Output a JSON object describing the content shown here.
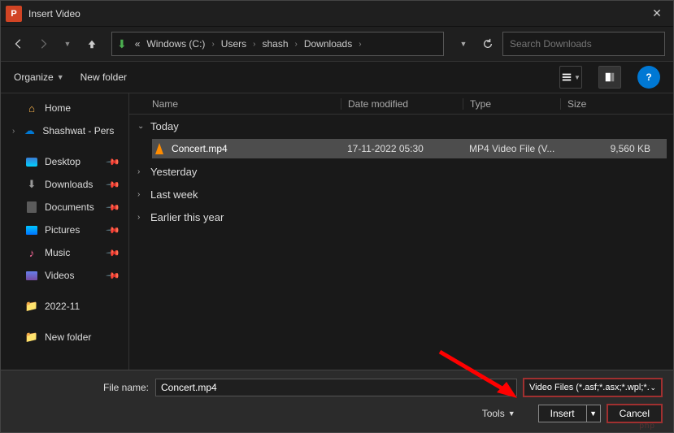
{
  "window": {
    "title": "Insert Video"
  },
  "breadcrumb": {
    "prefix": "«",
    "items": [
      "Windows (C:)",
      "Users",
      "shash",
      "Downloads"
    ]
  },
  "search": {
    "placeholder": "Search Downloads"
  },
  "toolbar": {
    "organize": "Organize",
    "new_folder": "New folder"
  },
  "sidebar": {
    "home": "Home",
    "onedrive": "Shashwat - Pers",
    "desktop": "Desktop",
    "downloads": "Downloads",
    "documents": "Documents",
    "pictures": "Pictures",
    "music": "Music",
    "videos": "Videos",
    "folder1": "2022-11",
    "folder2": "New folder"
  },
  "columns": {
    "name": "Name",
    "date": "Date modified",
    "type": "Type",
    "size": "Size"
  },
  "groups": {
    "today": "Today",
    "yesterday": "Yesterday",
    "lastweek": "Last week",
    "earlier": "Earlier this year"
  },
  "files": {
    "concert": {
      "name": "Concert.mp4",
      "date": "17-11-2022 05:30",
      "type": "MP4 Video File (V...",
      "size": "9,560 KB"
    }
  },
  "footer": {
    "filename_label": "File name:",
    "filename_value": "Concert.mp4",
    "filter": "Video Files (*.asf;*.asx;*.wpl;*.w",
    "tools": "Tools",
    "insert": "Insert",
    "cancel": "Cancel"
  }
}
